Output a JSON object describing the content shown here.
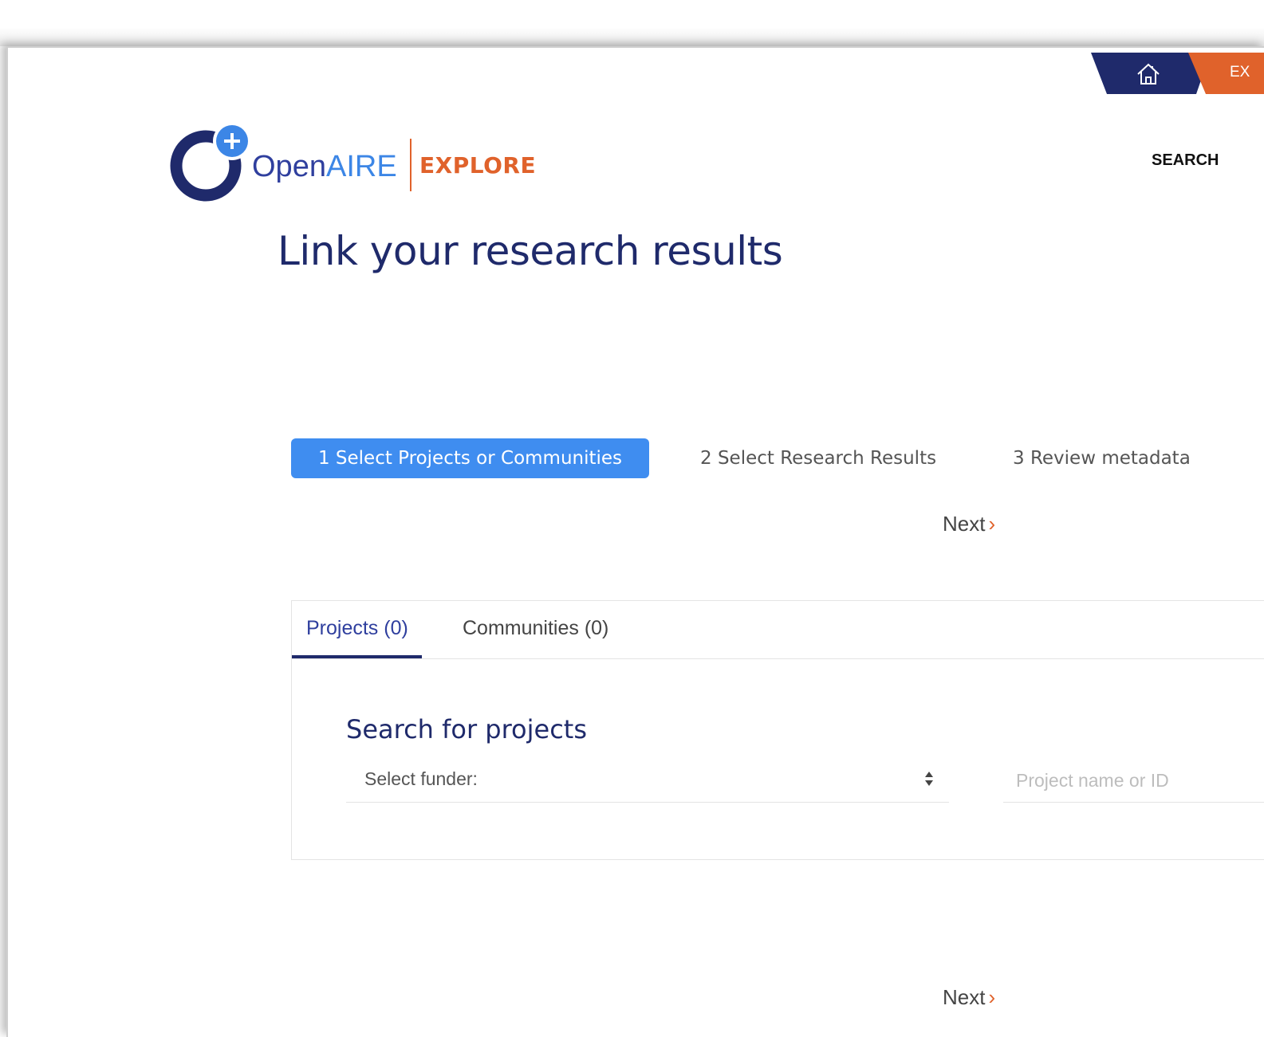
{
  "banner": {
    "home_icon": "home-icon",
    "explore_label": "EX"
  },
  "logo": {
    "open_text": "Open",
    "aire_text": "AIRE",
    "explore_text": "EXPLORE"
  },
  "nav": {
    "search_label": "SEARCH"
  },
  "page": {
    "title": "Link your research results"
  },
  "steps": [
    {
      "label": "1 Select Projects or Communities",
      "active": true
    },
    {
      "label": "2 Select Research Results",
      "active": false
    },
    {
      "label": "3 Review metadata",
      "active": false
    }
  ],
  "next": {
    "label": "Next",
    "chevron": "›"
  },
  "tabs": {
    "projects": "Projects (0)",
    "communities": "Communities (0)"
  },
  "search": {
    "heading": "Search for projects",
    "funder_label": "Select funder:",
    "project_placeholder": "Project name or ID"
  },
  "colors": {
    "brand_navy": "#1f2a6b",
    "brand_orange": "#e0622b",
    "active_step": "#3f8df0"
  }
}
